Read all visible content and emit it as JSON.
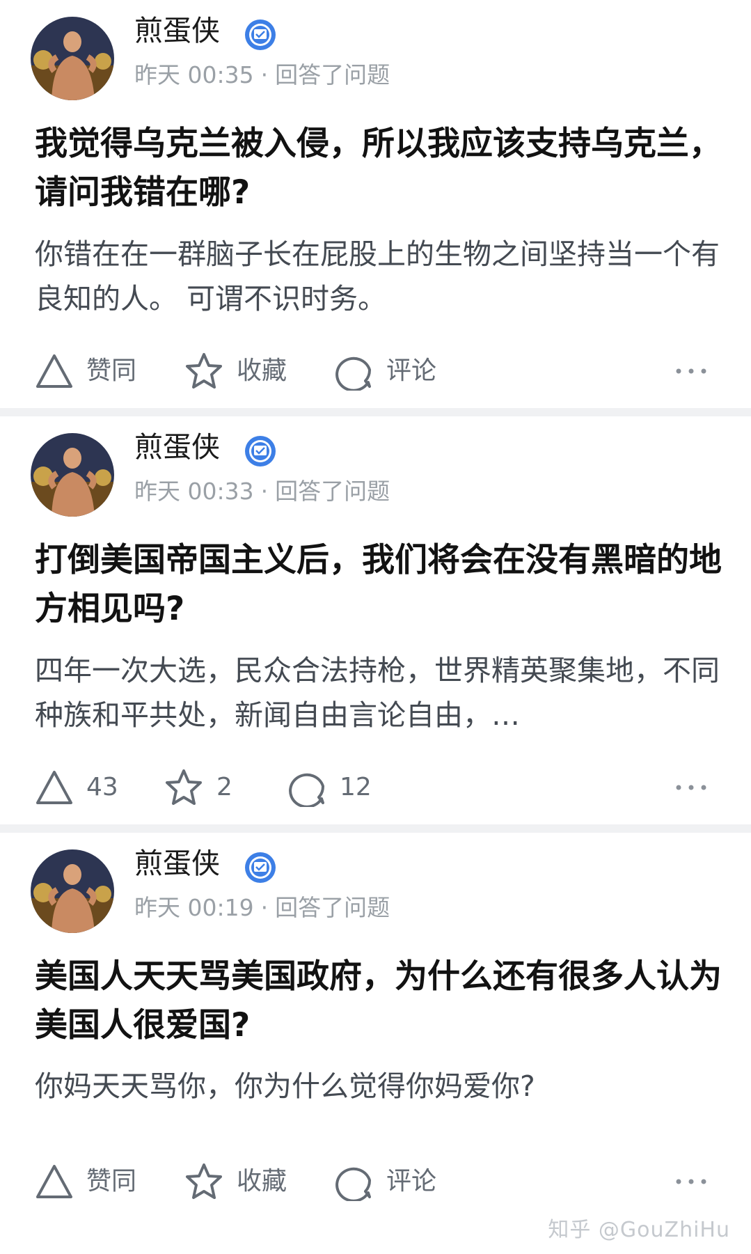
{
  "posts": [
    {
      "author": "煎蛋侠",
      "time": "昨天 00:35",
      "separator": "·",
      "action_text": "回答了问题",
      "title": "我觉得乌克兰被入侵，所以我应该支持乌克兰，请问我错在哪?",
      "excerpt": "你错在在一群脑子长在屁股上的生物之间坚持当一个有良知的人。 可谓不识时务。",
      "upvote_label": "赞同",
      "favorite_label": "收藏",
      "comment_label": "评论"
    },
    {
      "author": "煎蛋侠",
      "time": "昨天 00:33",
      "separator": "·",
      "action_text": "回答了问题",
      "title": "打倒美国帝国主义后，我们将会在没有黑暗的地方相见吗?",
      "excerpt": "四年一次大选，民众合法持枪，世界精英聚集地，不同种族和平共处，新闻自由言论自由，…",
      "upvote_label": "43",
      "favorite_label": "2",
      "comment_label": "12"
    },
    {
      "author": "煎蛋侠",
      "time": "昨天 00:19",
      "separator": "·",
      "action_text": "回答了问题",
      "title": "美国人天天骂美国政府，为什么还有很多人认为美国人很爱国?",
      "excerpt": "你妈天天骂你，你为什么觉得你妈爱你?",
      "upvote_label": "赞同",
      "favorite_label": "收藏",
      "comment_label": "评论"
    }
  ],
  "icons": {
    "upvote": "triangle-up-icon",
    "favorite": "star-icon",
    "comment": "speech-bubble-icon",
    "more": "more-horizontal-icon",
    "verified": "verified-badge-icon"
  },
  "colors": {
    "text_primary": "#121212",
    "text_secondary": "#9aa0a6",
    "action_gray": "#646b74",
    "badge_blue": "#3d7fe6",
    "separator_bg": "#f0f1f3"
  },
  "watermark": "知乎 @GouZhiHu"
}
